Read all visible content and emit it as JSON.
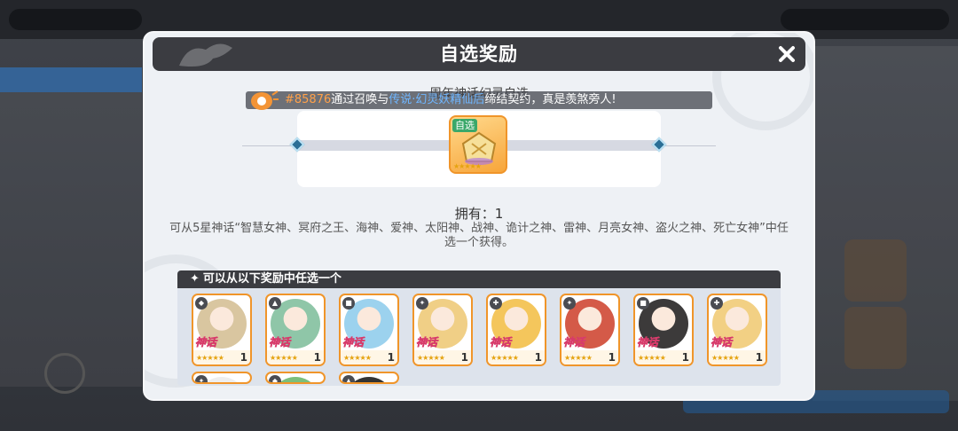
{
  "modal": {
    "title": "自选奖励",
    "close_icon": "close-icon"
  },
  "marquee": {
    "player_id": "#85876",
    "text_a": "通过召唤与",
    "text_b": "传说·幻灵",
    "text_c": "妖精仙后",
    "text_d": "缔结契约，真是羡煞旁人!"
  },
  "chest": {
    "title": "周年神话幻灵自选",
    "tag": "自选",
    "stars": "★★★★★"
  },
  "owned": {
    "label": "拥有：",
    "value": "1"
  },
  "description": "可从5星神话“智慧女神、冥府之王、海神、爱神、太阳神、战神、诡计之神、雷神、月亮女神、盗火之神、死亡女神”中任选一个获得。",
  "reward_section": {
    "title": "可以从以下奖励中任选一个",
    "items": [
      {
        "rarity": "神话",
        "qty": "1",
        "stars": "★★★★★",
        "element_icon": "shield-icon",
        "color": "#d9c6a0"
      },
      {
        "rarity": "神话",
        "qty": "1",
        "stars": "★★★★★",
        "element_icon": "helmet-icon",
        "color": "#8fc6a8"
      },
      {
        "rarity": "神话",
        "qty": "1",
        "stars": "★★★★★",
        "element_icon": "book-icon",
        "color": "#9cd2ee"
      },
      {
        "rarity": "神话",
        "qty": "1",
        "stars": "★★★★★",
        "element_icon": "sword-icon",
        "color": "#f0cf86"
      },
      {
        "rarity": "神话",
        "qty": "1",
        "stars": "★★★★★",
        "element_icon": "hammer-icon",
        "color": "#f4c65c"
      },
      {
        "rarity": "神话",
        "qty": "1",
        "stars": "★★★★★",
        "element_icon": "sword-icon",
        "color": "#d45a48"
      },
      {
        "rarity": "神话",
        "qty": "1",
        "stars": "★★★★★",
        "element_icon": "book-icon",
        "color": "#3c3a3a"
      },
      {
        "rarity": "神话",
        "qty": "1",
        "stars": "★★★★★",
        "element_icon": "hammer-icon",
        "color": "#f2d084"
      },
      {
        "element_icon": "sword-icon",
        "color": "#eeeeee"
      },
      {
        "element_icon": "shield-icon",
        "color": "#7bbf7b"
      },
      {
        "element_icon": "helmet-icon",
        "color": "#333333"
      }
    ]
  },
  "colors": {
    "accent_orange": "#f0952a",
    "header_dark": "#3b3c41",
    "modal_bg": "#eef1f5"
  }
}
